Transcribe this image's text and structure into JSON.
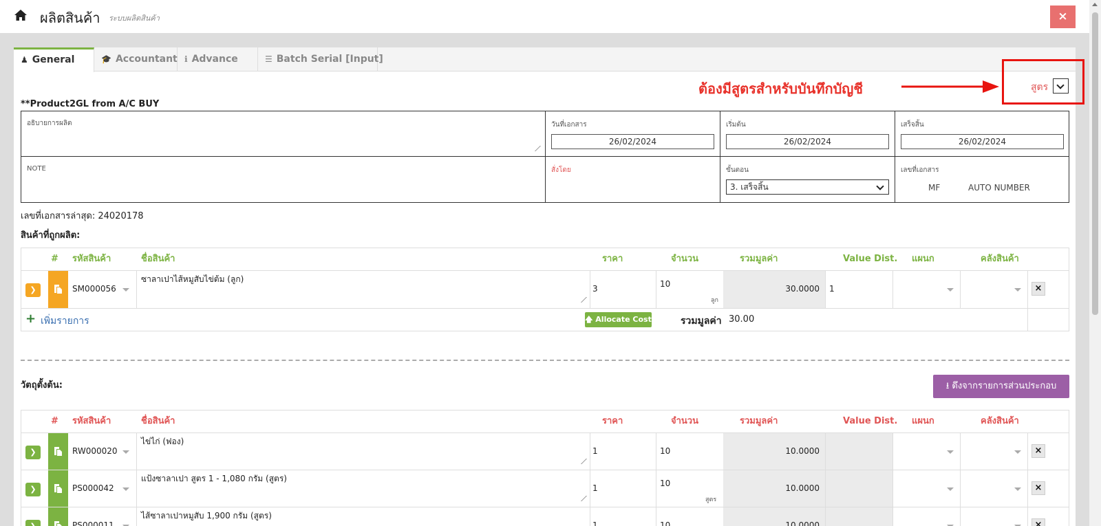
{
  "header": {
    "title": "ผลิตสินค้า",
    "subtitle": "ระบบผลิตสินค้า",
    "close_label": "×"
  },
  "tabs": [
    {
      "label": "General",
      "icon": "user-icon",
      "active": true
    },
    {
      "label": "Accountant",
      "icon": "graduation-cap-icon",
      "active": false
    },
    {
      "label": "Advance",
      "icon": "info-icon",
      "active": false
    },
    {
      "label": "Batch Serial [Input]",
      "icon": "barcode-icon",
      "active": false
    }
  ],
  "annotation": {
    "text": "ต้องมีสูตรสำหรับบันทึกบัญชี",
    "color": "#e8322b"
  },
  "formula": {
    "label": "สูตร"
  },
  "product_gl": "**Product2GL from A/C BUY",
  "form": {
    "description_label": "อธิบายการผลิต",
    "doc_date_label": "วันที่เอกสาร",
    "doc_date": "26/02/2024",
    "start_label": "เริ่มต้น",
    "start_date": "26/02/2024",
    "finish_label": "เสร็จสิ้น",
    "finish_date": "26/02/2024",
    "note_label": "NOTE",
    "ordered_by_label": "สั่งโดย",
    "step_label": "ขั้นตอน",
    "step_value": "3. เสร็จสิ้น",
    "doc_no_label": "เลขที่เอกสาร",
    "doc_prefix": "MF",
    "doc_auto": "AUTO NUMBER"
  },
  "last_doc": "เลขที่เอกสารล่าสุด: 24020178",
  "produced": {
    "section_label": "สินค้าที่ถูกผลิต:",
    "headers": {
      "hash": "#",
      "code": "รหัสสินค้า",
      "name": "ชื่อสินค้า",
      "price": "ราคา",
      "qty": "จำนวน",
      "total": "รวมมูลค่า",
      "value_dist": "Value Dist.",
      "dept": "แผนก",
      "warehouse": "คลังสินค้า"
    },
    "rows": [
      {
        "code": "SM000056",
        "name": "ซาลาเปาไส้หมูสับไข่ต้ม (ลูก)",
        "price": "3",
        "qty": "10",
        "unit": "ลูก",
        "total": "30.0000",
        "value_dist": "1"
      }
    ],
    "add_label": "เพิ่มรายการ",
    "allocate_label": "Allocate Cost",
    "sum_label": "รวมมูลค่า",
    "sum_value": "30.00"
  },
  "materials": {
    "section_label": "วัตถุตั้งต้น:",
    "pull_label": "ดึงจากรายการส่วนประกอบ",
    "headers": {
      "hash": "#",
      "code": "รหัสสินค้า",
      "name": "ชื่อสินค้า",
      "price": "ราคา",
      "qty": "จำนวน",
      "total": "รวมมูลค่า",
      "value_dist": "Value Dist.",
      "dept": "แผนก",
      "warehouse": "คลังสินค้า"
    },
    "rows": [
      {
        "code": "RW000020",
        "name": "ไข่ไก่ (ฟอง)",
        "price": "1",
        "qty": "10",
        "unit": "",
        "total": "10.0000"
      },
      {
        "code": "PS000042",
        "name": "แป้งซาลาเปา สูตร 1 - 1,080 กรัม (สูตร)",
        "price": "1",
        "qty": "10",
        "unit": "สูตร",
        "total": "10.0000"
      },
      {
        "code": "PS000011",
        "name": "ไส้ซาลาเปาหมูสับ 1,900 กรัม (สูตร)",
        "price": "1",
        "qty": "10",
        "unit": "",
        "total": "10.0000"
      }
    ]
  },
  "colors": {
    "accent_green": "#7cb342",
    "header_red": "#e05555",
    "close_red": "#e8706f",
    "orange": "#f5a623",
    "purple": "#9c5fa6",
    "link_blue": "#3a6fb0"
  }
}
